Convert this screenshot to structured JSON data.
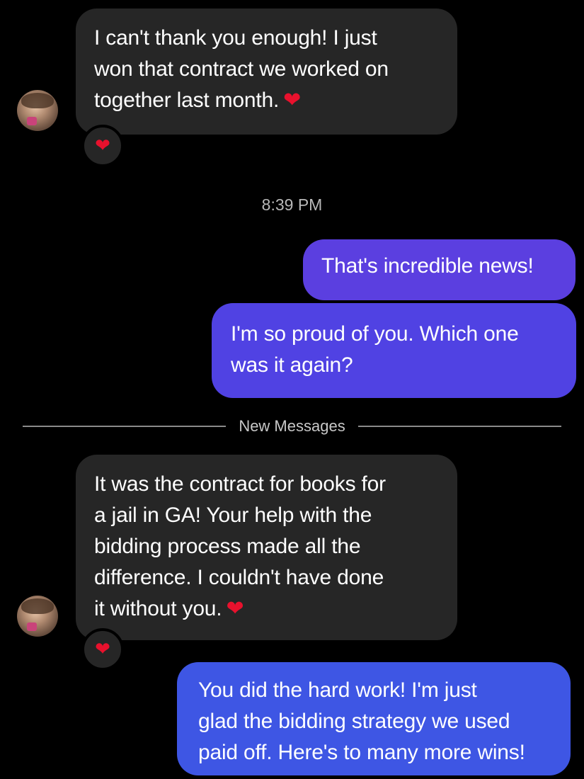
{
  "colors": {
    "background": "#000000",
    "incoming_bubble": "#262626",
    "outgoing_bubble_1": "#5b3fe0",
    "outgoing_bubble_2": "#5042e3",
    "outgoing_bubble_3": "#3e56e4",
    "heart": "#e8112d"
  },
  "messages": [
    {
      "direction": "incoming",
      "lines": [
        "I can't thank you enough! I just",
        "won that contract we worked on",
        "together last month."
      ],
      "emoji": "heart-emoji",
      "reaction": "heart-emoji"
    },
    {
      "direction": "outgoing",
      "lines": [
        "That's incredible news!"
      ]
    },
    {
      "direction": "outgoing",
      "lines": [
        "I'm so proud of you. Which one",
        "was it again?"
      ]
    },
    {
      "direction": "incoming",
      "lines": [
        "It was the contract for books for",
        "a jail in GA! Your help with the",
        "bidding process made all the",
        "difference. I couldn't have done",
        "it without you."
      ],
      "emoji": "heart-emoji",
      "reaction": "heart-emoji"
    },
    {
      "direction": "outgoing",
      "lines": [
        "You did the hard work! I'm just",
        "glad the bidding strategy we used",
        "paid off. Here's to many more wins!"
      ]
    }
  ],
  "timestamp": "8:39 PM",
  "divider_label": "New Messages"
}
